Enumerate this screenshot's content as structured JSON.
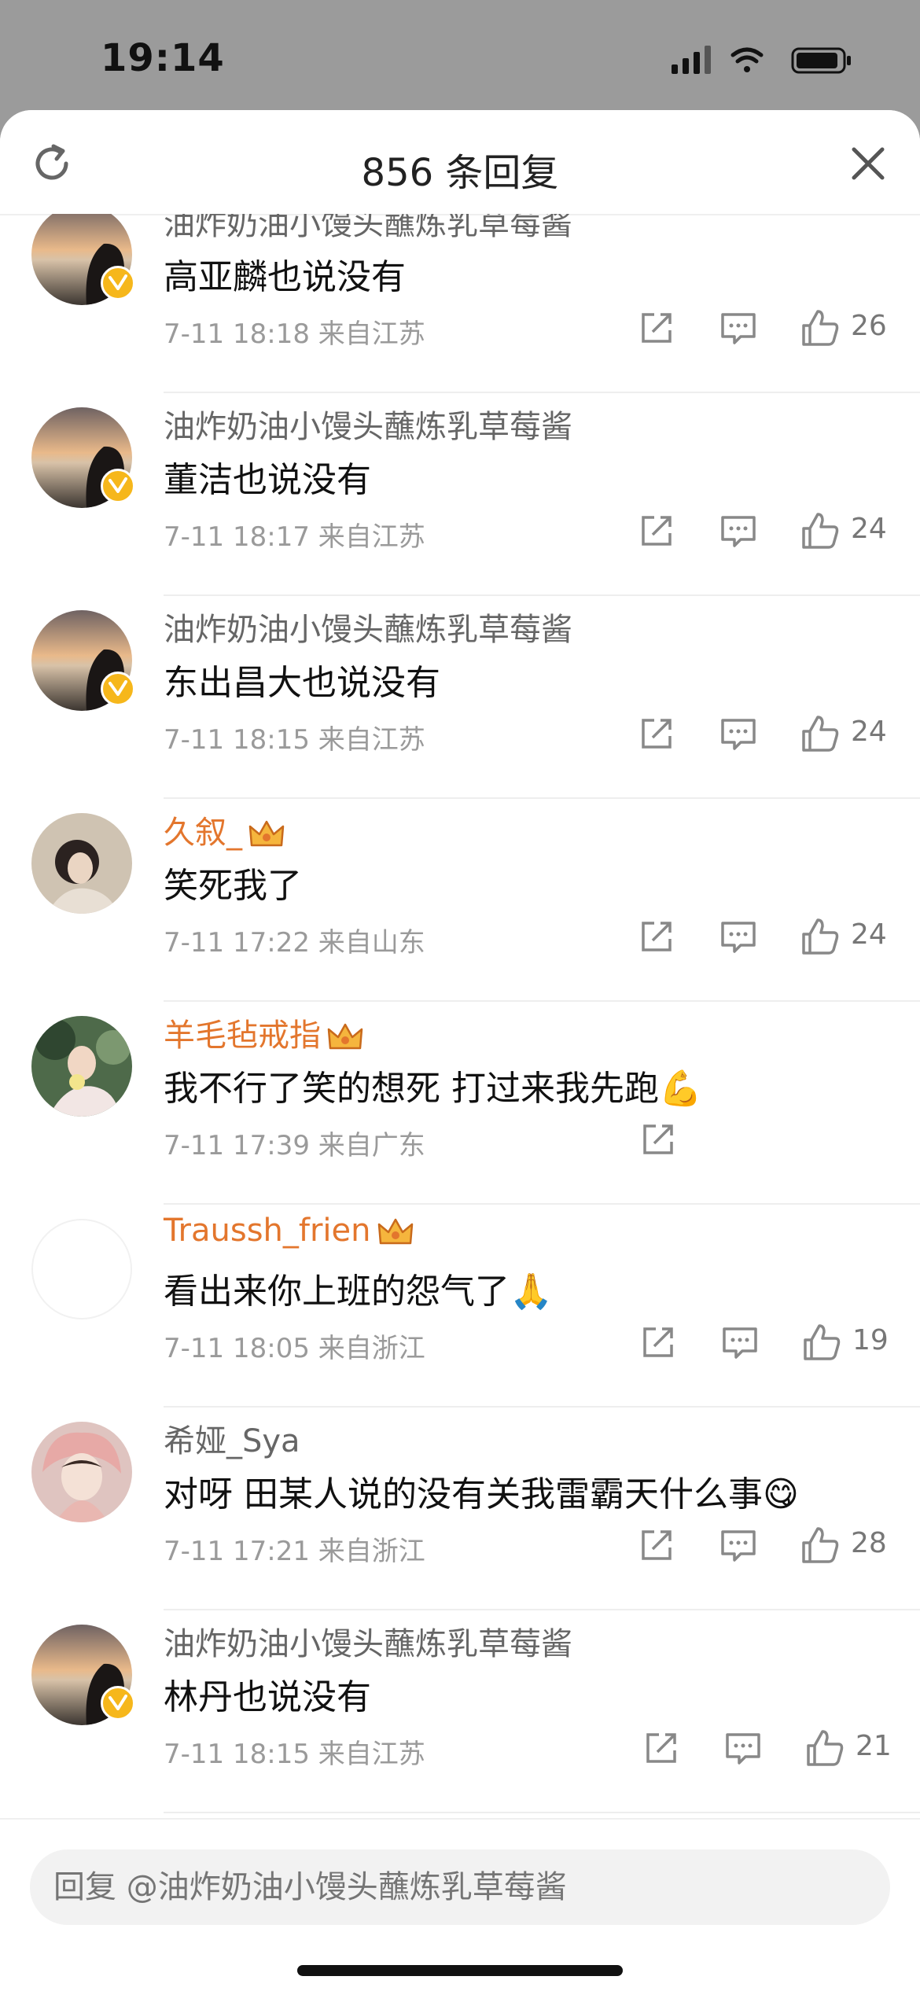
{
  "status_bar": {
    "time": "19:14"
  },
  "header": {
    "title": "856 条回复"
  },
  "comments": [
    {
      "user": "油炸奶油小馒头蘸炼乳草莓酱",
      "text": "高亚麟也说没有",
      "meta": "7-11 18:18  来自江苏",
      "likes": "26"
    },
    {
      "user": "油炸奶油小馒头蘸炼乳草莓酱",
      "text": "董洁也说没有",
      "meta": "7-11 18:17  来自江苏",
      "likes": "24"
    },
    {
      "user": "油炸奶油小馒头蘸炼乳草莓酱",
      "text": "东出昌大也说没有",
      "meta": "7-11 18:15  来自江苏",
      "likes": "24"
    },
    {
      "user": "久叙_",
      "text": "笑死我了",
      "meta": "7-11 17:22  来自山东",
      "likes": "24"
    },
    {
      "user": "羊毛毡戒指",
      "text": "我不行了笑的想死 打过来我先跑💪",
      "meta": "7-11 17:39  来自广东",
      "likes": ""
    },
    {
      "user": "Traussh_frien",
      "text": "看出来你上班的怨气了🙏",
      "meta": "7-11 18:05  来自浙江",
      "likes": "19"
    },
    {
      "user": "希娅_Sya",
      "text": "对呀 田某人说的没有关我雷霸天什么事😋",
      "meta": "7-11 17:21  来自浙江",
      "likes": "28"
    },
    {
      "user": "油炸奶油小馒头蘸炼乳草莓酱",
      "text": "林丹也说没有",
      "meta": "7-11 18:15  来自江苏",
      "likes": "21"
    }
  ],
  "reply": {
    "placeholder": "回复 @油炸奶油小馒头蘸炼乳草莓酱"
  },
  "colors": {
    "vip_name": "#e3762d",
    "verified_badge": "#f6b71b"
  }
}
